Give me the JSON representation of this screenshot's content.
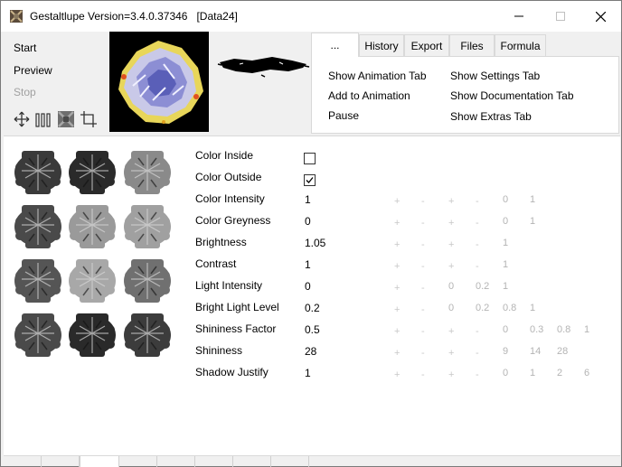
{
  "window": {
    "title": "Gestaltlupe Version=3.4.0.37346   [Data24]"
  },
  "commands": {
    "start": "Start",
    "preview": "Preview",
    "stop": "Stop"
  },
  "tools": [
    "move-icon",
    "columns-icon",
    "fractal-icon",
    "crop-icon"
  ],
  "tabs": [
    {
      "label": "...",
      "active": true
    },
    {
      "label": "History",
      "active": false
    },
    {
      "label": "Export",
      "active": false
    },
    {
      "label": "Files",
      "active": false
    },
    {
      "label": "Formula",
      "active": false
    }
  ],
  "tab_panel": {
    "show_animation_tab": "Show Animation Tab",
    "add_to_animation": "Add to Animation",
    "pause": "Pause",
    "show_settings_tab": "Show Settings Tab",
    "show_documentation_tab": "Show Documentation Tab",
    "show_extras_tab": "Show Extras Tab"
  },
  "settings": [
    {
      "label": "Color Inside",
      "type": "checkbox",
      "checked": false,
      "adjust": []
    },
    {
      "label": "Color Outside",
      "type": "checkbox",
      "checked": true,
      "adjust": []
    },
    {
      "label": "Color Intensity",
      "value": "1",
      "adjust": [
        "+",
        "-",
        "+",
        "-",
        "0",
        "1"
      ]
    },
    {
      "label": "Color Greyness",
      "value": "0",
      "adjust": [
        "+",
        "-",
        "+",
        "-",
        "0",
        "1"
      ]
    },
    {
      "label": "Brightness",
      "value": "1.05",
      "adjust": [
        "+",
        "-",
        "+",
        "-",
        "1"
      ]
    },
    {
      "label": "Contrast",
      "value": "1",
      "adjust": [
        "+",
        "-",
        "+",
        "-",
        "1"
      ]
    },
    {
      "label": "Light Intensity",
      "value": "0",
      "adjust": [
        "+",
        "-",
        "0",
        "0.2",
        "1"
      ]
    },
    {
      "label": "Bright Light Level",
      "value": "0.2",
      "adjust": [
        "+",
        "-",
        "0",
        "0.2",
        "0.8",
        "1"
      ]
    },
    {
      "label": "Shininess Factor",
      "value": "0.5",
      "adjust": [
        "+",
        "-",
        "+",
        "-",
        "0",
        "0.3",
        "0.8",
        "1"
      ]
    },
    {
      "label": "Shininess",
      "value": "28",
      "adjust": [
        "+",
        "-",
        "+",
        "-",
        "9",
        "14",
        "28"
      ]
    },
    {
      "label": "Shadow Justify",
      "value": "1",
      "adjust": [
        "+",
        "-",
        "+",
        "-",
        "0",
        "1",
        "2",
        "6"
      ]
    }
  ],
  "colors": {
    "window_bg": "#f0f0f0",
    "panel_bg": "#ffffff",
    "disabled_text": "#a0a0a0",
    "adjust_text": "#b4b4b4"
  }
}
